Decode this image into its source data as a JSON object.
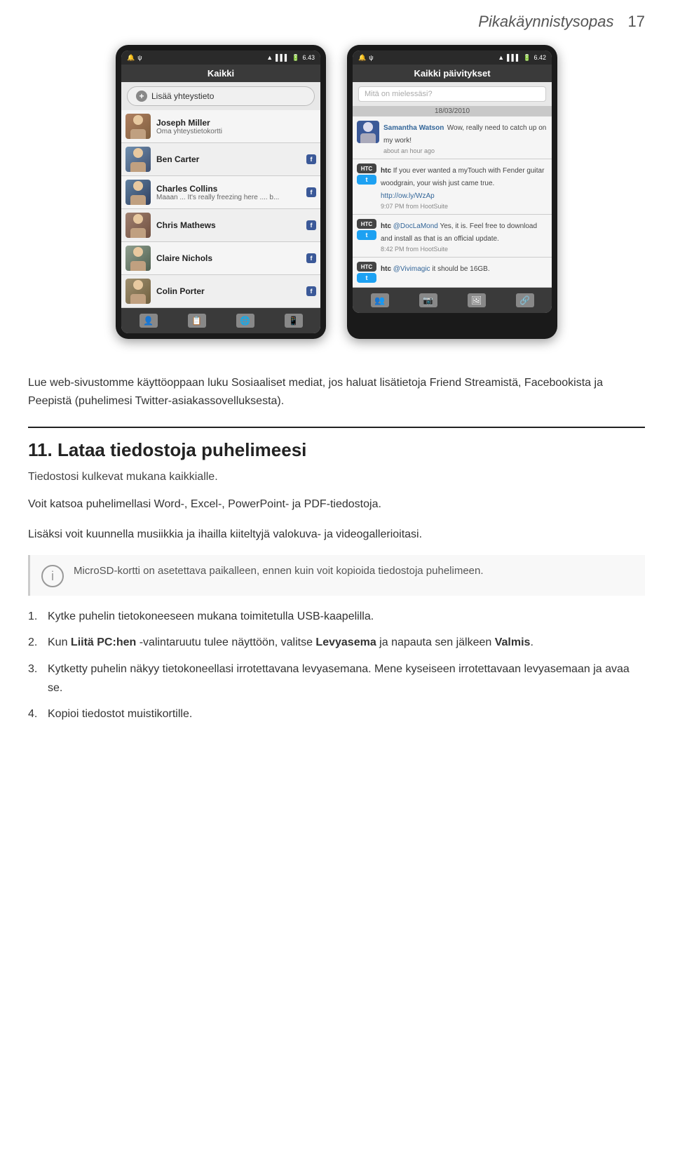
{
  "header": {
    "title": "Pikakäynnistysopas",
    "page_number": "17"
  },
  "left_phone": {
    "status_bar": {
      "left": "🔔 ψ",
      "right": "6.43"
    },
    "title": "Kaikki",
    "add_button": "Lisää yhteystieto",
    "contacts": [
      {
        "name": "Joseph Miller",
        "sub": "Oma yhteystietokortti",
        "fb": false,
        "avatar_class": "avatar-j",
        "initial": "J"
      },
      {
        "name": "Ben Carter",
        "sub": "",
        "fb": true,
        "avatar_class": "avatar-b",
        "initial": "B"
      },
      {
        "name": "Charles Collins",
        "sub": "Maaan ... It's really freezing here .... b...",
        "fb": true,
        "avatar_class": "avatar-c",
        "initial": "C"
      },
      {
        "name": "Chris Mathews",
        "sub": "",
        "fb": true,
        "avatar_class": "avatar-ch",
        "initial": "C"
      },
      {
        "name": "Claire Nichols",
        "sub": "",
        "fb": true,
        "avatar_class": "avatar-cl",
        "initial": "C"
      },
      {
        "name": "Colin Porter",
        "sub": "",
        "fb": true,
        "avatar_class": "avatar-co",
        "initial": "C"
      }
    ]
  },
  "right_phone": {
    "status_bar": {
      "left": "🔔 ψ",
      "right": "6.42"
    },
    "title": "Kaikki päivitykset",
    "search_placeholder": "Mitä on mielessäsi?",
    "date_header": "18/03/2010",
    "feed_items": [
      {
        "author": "Samantha Watson",
        "text": "Wow, really need to catch up on my work!",
        "time": "about an hour ago",
        "type": "fb"
      },
      {
        "author": "htc",
        "text": "If you ever wanted a myTouch with Fender guitar woodgrain, your wish just came true. http://ow.ly/WzAp",
        "time": "9:07 PM from HootSuite",
        "type": "htc-twitter"
      },
      {
        "author": "htc",
        "text": "@DocLaMond Yes, it is. Feel free to download and install as that is an official update.",
        "time": "8:42 PM from HootSuite",
        "type": "htc-twitter"
      },
      {
        "author": "htc",
        "text": "@Vivimagic it should be 16GB.",
        "time": "",
        "type": "htc-twitter"
      }
    ]
  },
  "intro_text": "Lue web-sivustomme käyttöoppaan luku Sosiaaliset mediat, jos haluat lisätietoja Friend Streamistä, Facebookista ja Peepistä (puhelimesi Twitter-asiakassovelluksesta).",
  "section": {
    "number": "11.",
    "title": "Lataa tiedostoja puhelimeesi",
    "subtitle": "Tiedostosi kulkevat mukana kaikkialle.",
    "body1": "Voit katsoa puhelimellasi Word-, Excel-, PowerPoint- ja PDF-tiedostoja.",
    "body2": "Lisäksi voit kuunnella musiikkia ja ihailla kiiteltyjä valokuva- ja videogallerioitasi.",
    "note": "MicroSD-kortti on asetettava paikalleen, ennen kuin voit kopioida tiedostoja puhelimeen.",
    "steps": [
      {
        "num": "1.",
        "text": "Kytke puhelin tietokoneeseen mukana toimitetulla USB-kaapelilla."
      },
      {
        "num": "2.",
        "text_before": "Kun ",
        "bold": "Liitä PC:hen",
        "text_middle": " -valintaruutu tulee näyttöön, valitse ",
        "bold2": "Levyasema",
        "text_after": " ja napauta sen jälkeen ",
        "bold3": "Valmis",
        "text_end": "."
      },
      {
        "num": "3.",
        "text": "Kytketty puhelin näkyy tietokoneellasi irrotettavana levyasemana. Mene kyseiseen irrotettavaan levyasemaan ja avaa se."
      },
      {
        "num": "4.",
        "text": "Kopioi tiedostot muistikortille."
      }
    ]
  }
}
